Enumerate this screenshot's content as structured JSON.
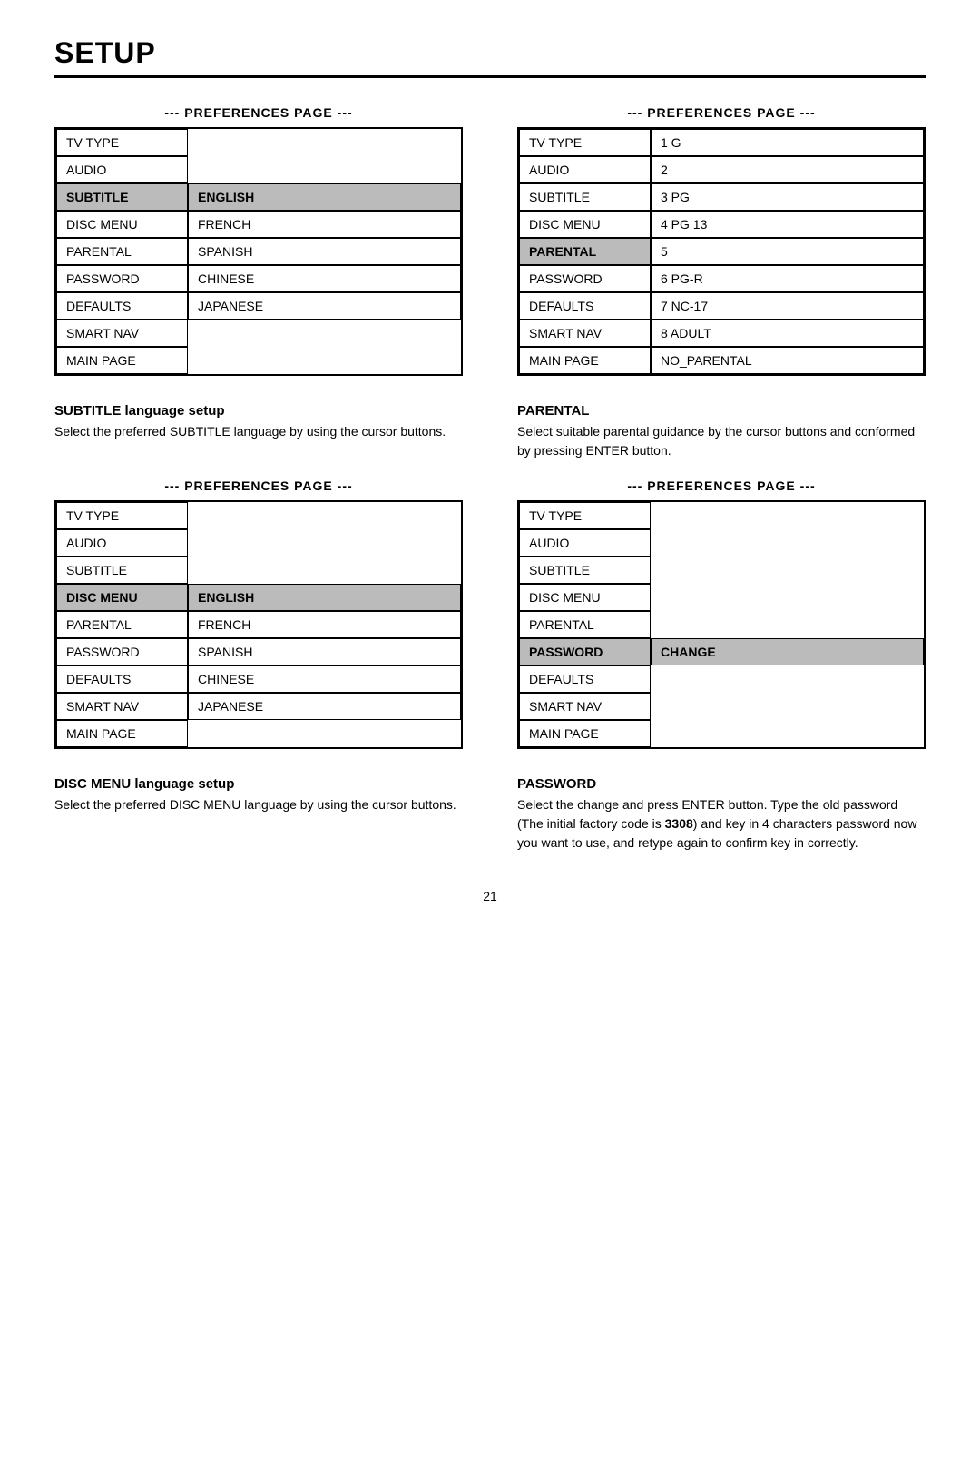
{
  "page": {
    "title": "SETUP",
    "page_number": "21"
  },
  "panels": {
    "top_left": {
      "label": "--- PREFERENCES PAGE ---",
      "rows": [
        {
          "left": "TV TYPE",
          "right": "",
          "left_highlight": false,
          "right_highlight": false
        },
        {
          "left": "AUDIO",
          "right": "",
          "left_highlight": false,
          "right_highlight": false
        },
        {
          "left": "SUBTITLE",
          "right": "ENGLISH",
          "left_highlight": true,
          "right_highlight": true
        },
        {
          "left": "DISC MENU",
          "right": "FRENCH",
          "left_highlight": false,
          "right_highlight": false
        },
        {
          "left": "PARENTAL",
          "right": "SPANISH",
          "left_highlight": false,
          "right_highlight": false
        },
        {
          "left": "PASSWORD",
          "right": "CHINESE",
          "left_highlight": false,
          "right_highlight": false
        },
        {
          "left": "DEFAULTS",
          "right": "JAPANESE",
          "left_highlight": false,
          "right_highlight": false
        },
        {
          "left": "SMART NAV",
          "right": "",
          "left_highlight": false,
          "right_highlight": false
        },
        {
          "left": "MAIN PAGE",
          "right": "",
          "left_highlight": false,
          "right_highlight": false
        }
      ]
    },
    "top_right": {
      "label": "--- PREFERENCES PAGE ---",
      "rows": [
        {
          "left": "TV TYPE",
          "right": "1 G",
          "left_highlight": false,
          "right_highlight": false
        },
        {
          "left": "AUDIO",
          "right": "2",
          "left_highlight": false,
          "right_highlight": false
        },
        {
          "left": "SUBTITLE",
          "right": "3 PG",
          "left_highlight": false,
          "right_highlight": false
        },
        {
          "left": "DISC MENU",
          "right": "4 PG 13",
          "left_highlight": false,
          "right_highlight": false
        },
        {
          "left": "PARENTAL",
          "right": "5",
          "left_highlight": true,
          "right_highlight": false
        },
        {
          "left": "PASSWORD",
          "right": "6 PG-R",
          "left_highlight": false,
          "right_highlight": false
        },
        {
          "left": "DEFAULTS",
          "right": "7 NC-17",
          "left_highlight": false,
          "right_highlight": false
        },
        {
          "left": "SMART NAV",
          "right": "8 ADULT",
          "left_highlight": false,
          "right_highlight": false
        },
        {
          "left": "MAIN PAGE",
          "right": "NO_PARENTAL",
          "left_highlight": false,
          "right_highlight": false
        }
      ]
    },
    "bottom_left": {
      "label": "--- PREFERENCES PAGE ---",
      "rows": [
        {
          "left": "TV TYPE",
          "right": "",
          "left_highlight": false,
          "right_highlight": false
        },
        {
          "left": "AUDIO",
          "right": "",
          "left_highlight": false,
          "right_highlight": false
        },
        {
          "left": "SUBTITLE",
          "right": "",
          "left_highlight": false,
          "right_highlight": false
        },
        {
          "left": "DISC MENU",
          "right": "ENGLISH",
          "left_highlight": true,
          "right_highlight": true
        },
        {
          "left": "PARENTAL",
          "right": "FRENCH",
          "left_highlight": false,
          "right_highlight": false
        },
        {
          "left": "PASSWORD",
          "right": "SPANISH",
          "left_highlight": false,
          "right_highlight": false
        },
        {
          "left": "DEFAULTS",
          "right": "CHINESE",
          "left_highlight": false,
          "right_highlight": false
        },
        {
          "left": "SMART NAV",
          "right": "JAPANESE",
          "left_highlight": false,
          "right_highlight": false
        },
        {
          "left": "MAIN PAGE",
          "right": "",
          "left_highlight": false,
          "right_highlight": false
        }
      ]
    },
    "bottom_right": {
      "label": "--- PREFERENCES PAGE ---",
      "rows": [
        {
          "left": "TV TYPE",
          "right": "",
          "left_highlight": false,
          "right_highlight": false
        },
        {
          "left": "AUDIO",
          "right": "",
          "left_highlight": false,
          "right_highlight": false
        },
        {
          "left": "SUBTITLE",
          "right": "",
          "left_highlight": false,
          "right_highlight": false
        },
        {
          "left": "DISC MENU",
          "right": "",
          "left_highlight": false,
          "right_highlight": false
        },
        {
          "left": "PARENTAL",
          "right": "",
          "left_highlight": false,
          "right_highlight": false
        },
        {
          "left": "PASSWORD",
          "right": "CHANGE",
          "left_highlight": true,
          "right_highlight": true
        },
        {
          "left": "DEFAULTS",
          "right": "",
          "left_highlight": false,
          "right_highlight": false
        },
        {
          "left": "SMART NAV",
          "right": "",
          "left_highlight": false,
          "right_highlight": false
        },
        {
          "left": "MAIN PAGE",
          "right": "",
          "left_highlight": false,
          "right_highlight": false
        }
      ]
    }
  },
  "descriptions": {
    "subtitle": {
      "title": "SUBTITLE language setup",
      "body": "Select the preferred SUBTITLE language by using the cursor buttons."
    },
    "parental": {
      "title": "PARENTAL",
      "body": "Select suitable parental guidance by the cursor buttons and conformed by pressing ENTER button."
    },
    "disc_menu": {
      "title": "DISC MENU language setup",
      "body": "Select the preferred DISC MENU language by using the cursor buttons."
    },
    "password": {
      "title": "PASSWORD",
      "body_before_bold": "Select the change and press ENTER button. Type the old password (The initial factory code is ",
      "bold": "3308",
      "body_after_bold": ") and key in 4 characters password now you want to use, and retype again to confirm key in correctly."
    }
  }
}
